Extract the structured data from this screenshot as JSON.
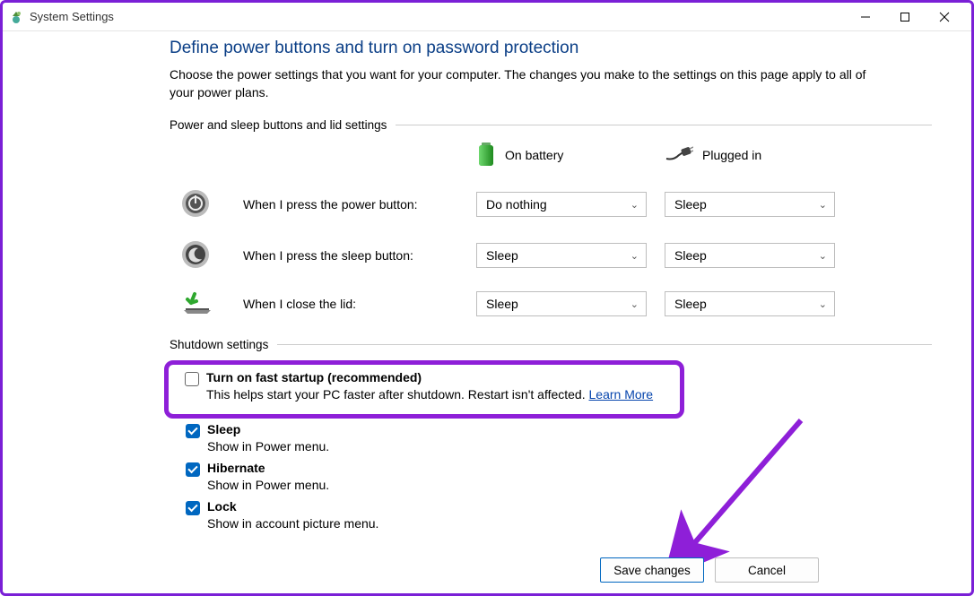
{
  "window": {
    "title": "System Settings"
  },
  "page": {
    "heading": "Define power buttons and turn on password protection",
    "description": "Choose the power settings that you want for your computer. The changes you make to the settings on this page apply to all of your power plans."
  },
  "section_power": {
    "title": "Power and sleep buttons and lid settings",
    "col_battery": "On battery",
    "col_plugged": "Plugged in",
    "rows": [
      {
        "icon": "power-button-icon",
        "label": "When I press the power button:",
        "battery": "Do nothing",
        "plugged": "Sleep"
      },
      {
        "icon": "sleep-button-icon",
        "label": "When I press the sleep button:",
        "battery": "Sleep",
        "plugged": "Sleep"
      },
      {
        "icon": "lid-icon",
        "label": "When I close the lid:",
        "battery": "Sleep",
        "plugged": "Sleep"
      }
    ]
  },
  "section_shutdown": {
    "title": "Shutdown settings",
    "items": [
      {
        "checked": false,
        "title": "Turn on fast startup (recommended)",
        "desc": "This helps start your PC faster after shutdown. Restart isn't affected.",
        "link": "Learn More"
      },
      {
        "checked": true,
        "title": "Sleep",
        "desc": "Show in Power menu."
      },
      {
        "checked": true,
        "title": "Hibernate",
        "desc": "Show in Power menu."
      },
      {
        "checked": true,
        "title": "Lock",
        "desc": "Show in account picture menu."
      }
    ]
  },
  "footer": {
    "save": "Save changes",
    "cancel": "Cancel"
  }
}
